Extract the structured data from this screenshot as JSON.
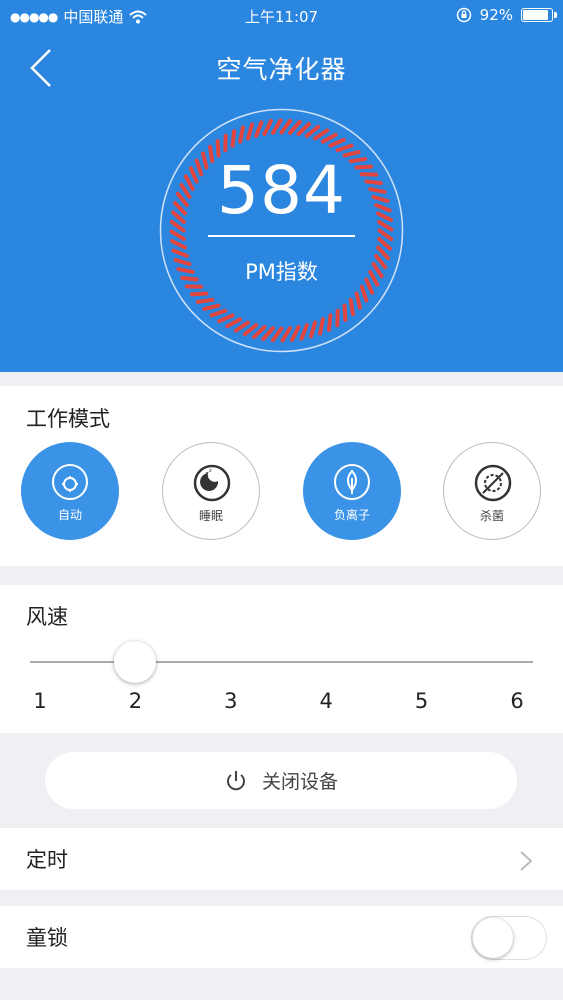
{
  "status_bar": {
    "signal": "●●●●●",
    "carrier": "中国联通",
    "wifi_icon": "wifi-icon",
    "time": "上午11:07",
    "orientation_lock_icon": "orientation-lock-icon",
    "battery_text": "92%",
    "battery_level": 0.92
  },
  "header": {
    "back_icon": "chevron-left-icon",
    "title": "空气净化器",
    "pm_value": "584",
    "pm_label": "PM指数",
    "ring_color": "#e0463f",
    "background_color": "#2b86e0"
  },
  "work_mode": {
    "title": "工作模式",
    "modes": [
      {
        "label": "自动",
        "icon": "auto-mode-icon",
        "active": true
      },
      {
        "label": "睡眠",
        "icon": "sleep-moon-icon",
        "active": false
      },
      {
        "label": "负离子",
        "icon": "leaf-icon",
        "active": true
      },
      {
        "label": "杀菌",
        "icon": "sterilize-icon",
        "active": false
      }
    ]
  },
  "wind_speed": {
    "title": "风速",
    "ticks": [
      "1",
      "2",
      "3",
      "4",
      "5",
      "6"
    ],
    "value": 2
  },
  "power": {
    "icon": "power-icon",
    "label": "关闭设备"
  },
  "timer": {
    "label": "定时",
    "icon": "chevron-right-icon"
  },
  "child_lock": {
    "label": "童锁",
    "on": false
  }
}
